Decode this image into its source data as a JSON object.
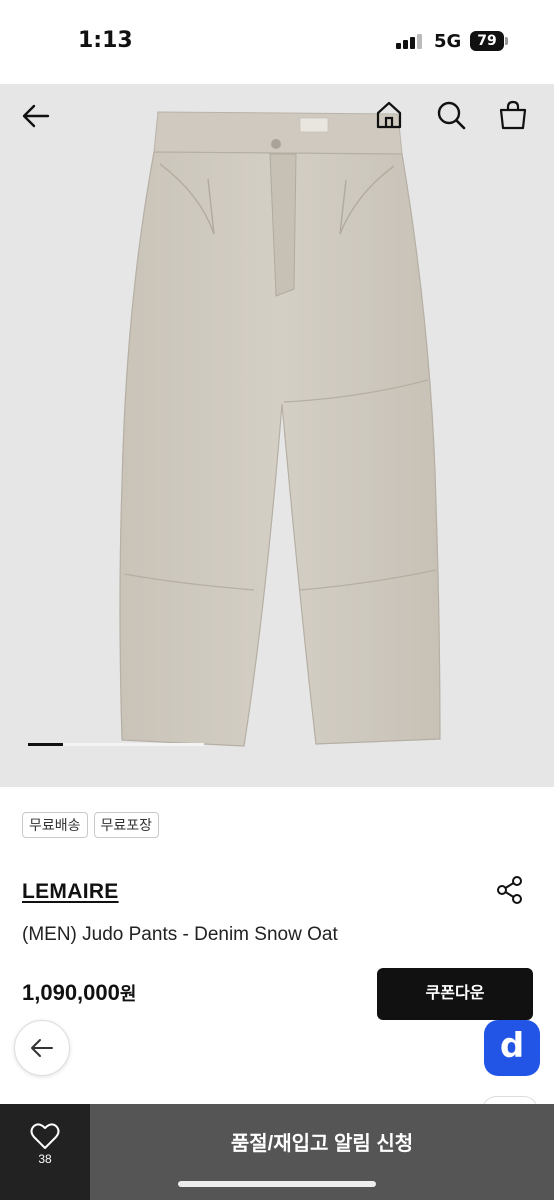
{
  "status_bar": {
    "time": "1:13",
    "network": "5G",
    "battery": "79"
  },
  "icons": {
    "back": "arrow-left-icon",
    "home": "home-icon",
    "search": "search-icon",
    "cart": "shopping-bag-icon",
    "share": "share-icon",
    "like": "heart-icon"
  },
  "gallery": {
    "current_index": 1,
    "progress": 0.2
  },
  "tags": [
    "무료배송",
    "무료포장"
  ],
  "product": {
    "brand": "LEMAIRE",
    "name": "(MEN) Judo Pants - Denim Snow Oat",
    "price": "1,090,000",
    "currency": "원"
  },
  "buttons": {
    "coupon": "쿠폰다운",
    "restock": "품절/재입고 알림 신청",
    "floating_badge": "d"
  },
  "likes": {
    "count": "38"
  },
  "colors": {
    "accent": "#2255e6",
    "dark": "#111111",
    "bottom_bar": "#555555",
    "image_bg": "#e6e6e6"
  }
}
